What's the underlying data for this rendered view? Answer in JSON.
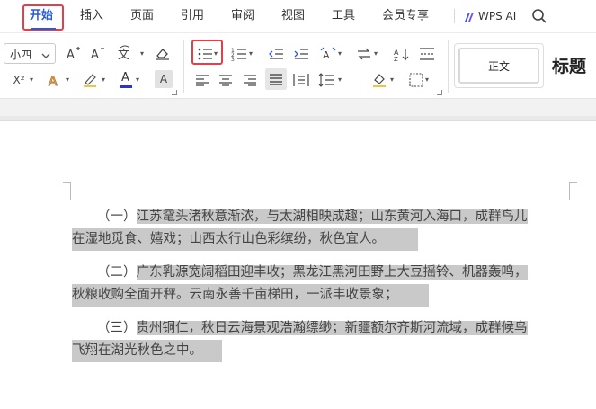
{
  "menu": {
    "tabs": [
      {
        "label": "开始",
        "active": true
      },
      {
        "label": "插入"
      },
      {
        "label": "页面"
      },
      {
        "label": "引用"
      },
      {
        "label": "审阅"
      },
      {
        "label": "视图"
      },
      {
        "label": "工具"
      },
      {
        "label": "会员专享"
      }
    ],
    "wps_ai": "WPS AI"
  },
  "toolbar": {
    "font_size": "小四",
    "grow_font": "A⁺",
    "shrink_font": "A⁻",
    "pinyin": "wén",
    "superscript": "X²",
    "font_color_label": "A",
    "char_shading": "A",
    "styles": {
      "normal": "正文",
      "heading": "标题"
    },
    "accent_color": "#2a5bd7",
    "highlight_color": "#e0404a"
  },
  "document": {
    "paragraphs": [
      {
        "lines": [
          "（一）江苏鼋头渚秋意渐浓，与太湖相映成趣；山东黄河入海口，成群鸟儿",
          "在湿地觅食、嬉戏；山西太行山色彩缤纷，秋色宜人。"
        ]
      },
      {
        "lines": [
          "（二）广东乳源宽阔稻田迎丰收；黑龙江黑河田野上大豆摇铃、机器轰鸣，",
          "秋粮收购全面开秤。云南永善千亩梯田，一派丰收景象；"
        ]
      },
      {
        "lines": [
          "（三）贵州铜仁，秋日云海景观浩瀚缥缈；新疆额尔齐斯河流域，成群候鸟",
          "飞翔在湖光秋色之中。"
        ]
      }
    ]
  }
}
